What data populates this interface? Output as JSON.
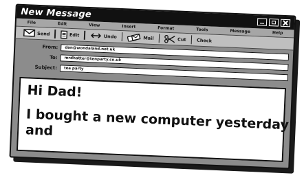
{
  "window": {
    "title": "New Message"
  },
  "menu": {
    "items": [
      "File",
      "Edit",
      "View",
      "Insert",
      "Format",
      "Tools",
      "Message",
      "Help"
    ]
  },
  "toolbar": {
    "send_label": "Send",
    "edit_label": "Edit",
    "undo_label": "Undo",
    "mail_label": "Mail",
    "cut_label": "Cut",
    "check_label": "Check"
  },
  "fields": {
    "from_label": "From:",
    "from_value": "dan@wondaland.net.uk",
    "to_label": "To:",
    "to_value": "mrdhatter@tenparty.co.uk",
    "subject_label": "Subject:",
    "subject_value": "tea party"
  },
  "body": {
    "line1": "Hi Dad!",
    "line2": "I bought a new computer yesterday",
    "line3": "and"
  }
}
